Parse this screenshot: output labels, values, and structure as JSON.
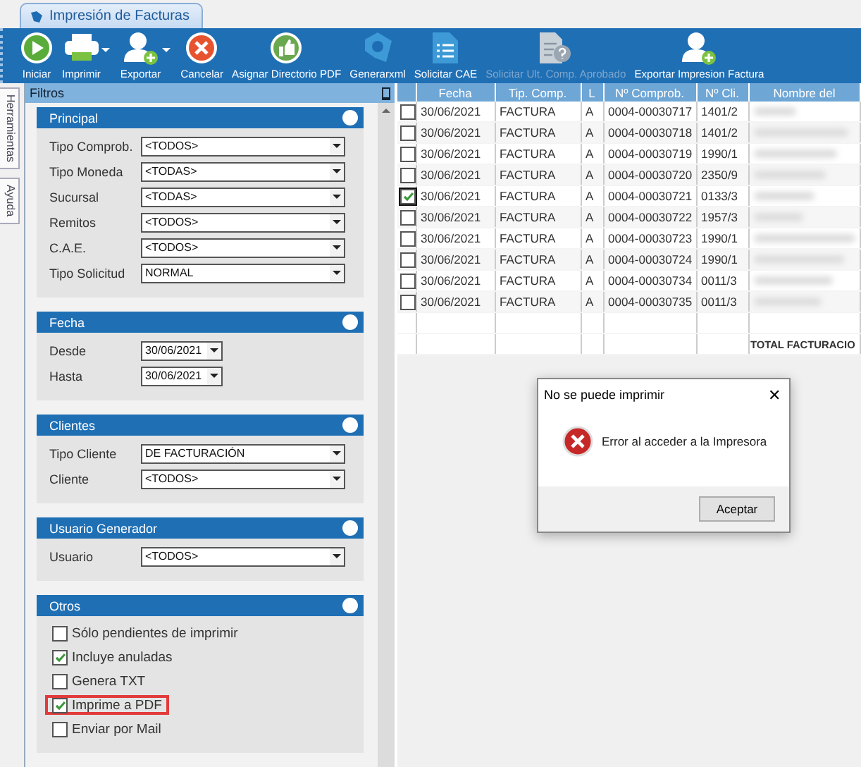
{
  "document_tab": {
    "title": "Impresión de Facturas"
  },
  "toolbar": [
    {
      "label": "Iniciar",
      "kind": "play",
      "dropdown": false,
      "disabled": false
    },
    {
      "label": "Imprimir",
      "kind": "printer",
      "dropdown": true,
      "disabled": false
    },
    {
      "label": "Exportar",
      "kind": "user-add",
      "dropdown": true,
      "disabled": false
    },
    {
      "label": "Cancelar",
      "kind": "cancel",
      "dropdown": false,
      "disabled": false
    },
    {
      "label": "Asignar Directorio PDF",
      "kind": "thumb",
      "dropdown": false,
      "disabled": false
    },
    {
      "label": "Generarxml",
      "kind": "shape",
      "dropdown": false,
      "disabled": false
    },
    {
      "label": "Solicitar CAE",
      "kind": "list-doc",
      "dropdown": false,
      "disabled": false
    },
    {
      "label": "Solicitar Ult. Comp. Aprobado",
      "kind": "question-doc",
      "dropdown": false,
      "disabled": true
    },
    {
      "label": "Exportar Impresion Factura",
      "kind": "user-add",
      "dropdown": false,
      "disabled": false
    }
  ],
  "side_tabs": [
    "Herramientas",
    "Ayuda"
  ],
  "filters": {
    "title": "Filtros",
    "sections": [
      {
        "title": "Principal",
        "rows": [
          {
            "kind": "select",
            "label": "Tipo Comprob.",
            "value": "<TODOS>"
          },
          {
            "kind": "select",
            "label": "Tipo Moneda",
            "value": "<TODAS>"
          },
          {
            "kind": "select",
            "label": "Sucursal",
            "value": "<TODAS>"
          },
          {
            "kind": "select",
            "label": "Remitos",
            "value": "<TODOS>"
          },
          {
            "kind": "select",
            "label": "C.A.E.",
            "value": "<TODOS>"
          },
          {
            "kind": "select",
            "label": "Tipo Solicitud",
            "value": "NORMAL"
          }
        ]
      },
      {
        "title": "Fecha",
        "rows": [
          {
            "kind": "date",
            "label": "Desde",
            "value": "30/06/2021"
          },
          {
            "kind": "date",
            "label": "Hasta",
            "value": "30/06/2021"
          }
        ]
      },
      {
        "title": "Clientes",
        "rows": [
          {
            "kind": "select",
            "label": "Tipo Cliente",
            "value": "DE FACTURACIÓN"
          },
          {
            "kind": "select",
            "label": "Cliente",
            "value": "<TODOS>"
          }
        ]
      },
      {
        "title": "Usuario Generador",
        "rows": [
          {
            "kind": "select",
            "label": "Usuario",
            "value": "<TODOS>"
          }
        ]
      },
      {
        "title": "Otros",
        "rows": [
          {
            "kind": "check",
            "label": "Sólo pendientes de imprimir",
            "checked": false,
            "highlighted": false
          },
          {
            "kind": "check",
            "label": "Incluye anuladas",
            "checked": true,
            "highlighted": false
          },
          {
            "kind": "check",
            "label": "Genera TXT",
            "checked": false,
            "highlighted": false
          },
          {
            "kind": "check",
            "label": "Imprime a PDF",
            "checked": true,
            "highlighted": true
          },
          {
            "kind": "check",
            "label": "Enviar por Mail",
            "checked": false,
            "highlighted": false
          }
        ]
      }
    ]
  },
  "table": {
    "columns": [
      "Fecha",
      "Tip. Comp.",
      "L",
      "Nº Comprob.",
      "Nº Cli.",
      "Nombre del"
    ],
    "rows": [
      {
        "checked": false,
        "cells": [
          "30/06/2021",
          "FACTURA",
          "A",
          "0004-00030717",
          "1401/2"
        ]
      },
      {
        "checked": false,
        "cells": [
          "30/06/2021",
          "FACTURA",
          "A",
          "0004-00030718",
          "1401/2"
        ]
      },
      {
        "checked": false,
        "cells": [
          "30/06/2021",
          "FACTURA",
          "A",
          "0004-00030719",
          "1990/1"
        ]
      },
      {
        "checked": false,
        "cells": [
          "30/06/2021",
          "FACTURA",
          "A",
          "0004-00030720",
          "2350/9"
        ]
      },
      {
        "checked": true,
        "cells": [
          "30/06/2021",
          "FACTURA",
          "A",
          "0004-00030721",
          "0133/3"
        ]
      },
      {
        "checked": false,
        "cells": [
          "30/06/2021",
          "FACTURA",
          "A",
          "0004-00030722",
          "1957/3"
        ]
      },
      {
        "checked": false,
        "cells": [
          "30/06/2021",
          "FACTURA",
          "A",
          "0004-00030723",
          "1990/1"
        ]
      },
      {
        "checked": false,
        "cells": [
          "30/06/2021",
          "FACTURA",
          "A",
          "0004-00030724",
          "1990/1"
        ]
      },
      {
        "checked": false,
        "cells": [
          "30/06/2021",
          "FACTURA",
          "A",
          "0004-00030734",
          "0011/3"
        ]
      },
      {
        "checked": false,
        "cells": [
          "30/06/2021",
          "FACTURA",
          "A",
          "0004-00030735",
          "0011/3"
        ]
      }
    ],
    "total_label": "TOTAL FACTURACIO"
  },
  "dialog": {
    "title": "No se puede imprimir",
    "close": "✕",
    "message": "Error al acceder a la Impresora",
    "button": "Aceptar"
  }
}
